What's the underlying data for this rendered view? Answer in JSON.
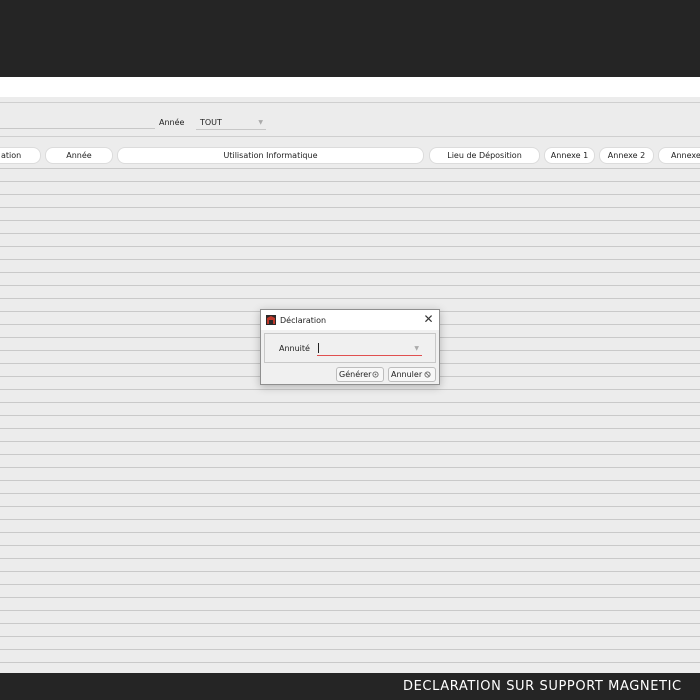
{
  "filters": {
    "annee_label": "Année",
    "annee_value": "TOUT"
  },
  "columns": [
    "ation",
    "Année",
    "Utilisation Informatique",
    "Lieu de Déposition",
    "Annexe 1",
    "Annexe 2",
    "Annexe"
  ],
  "dialog": {
    "title": "Déclaration",
    "field_label": "Annuité",
    "field_value": "",
    "generate_label": "Générer",
    "cancel_label": "Annuler"
  },
  "footer": {
    "title": "DECLARATION SUR SUPPORT MAGNETIC"
  },
  "icons": {
    "app": "app-logo-icon",
    "close": "close-icon",
    "dropdown": "chevron-down-icon",
    "generate": "gear-icon",
    "cancel": "cancel-icon"
  },
  "colors": {
    "topbar": "#252525",
    "background": "#ececec",
    "input_underline": "#e05050",
    "app_icon": "#c0392b"
  }
}
